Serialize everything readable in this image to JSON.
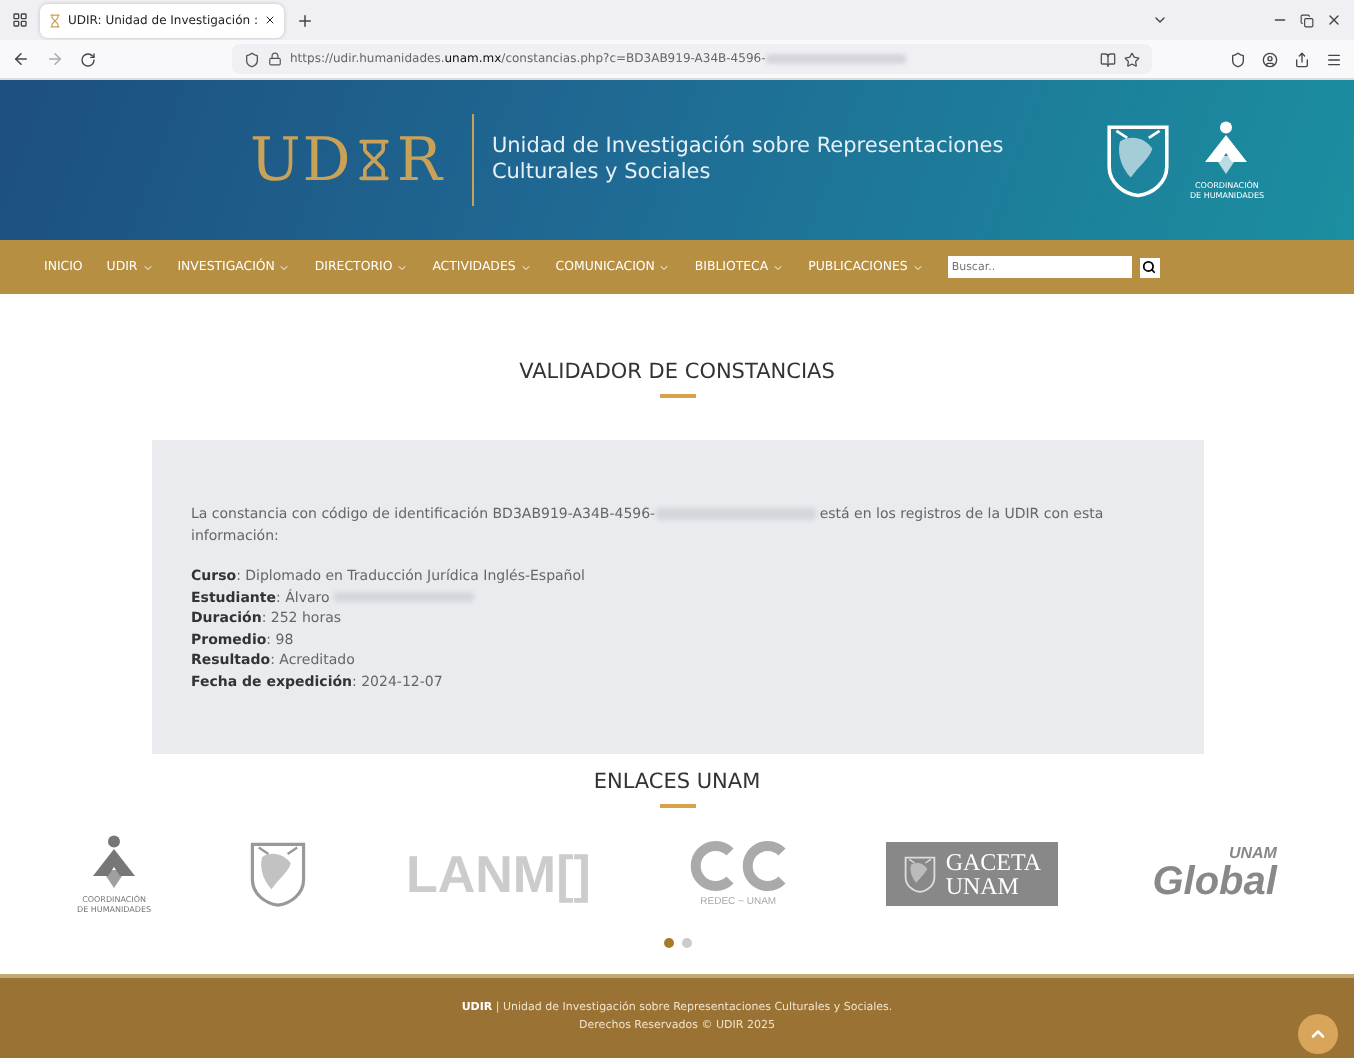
{
  "browser": {
    "tab_title": "UDIR: Unidad de Investigación :",
    "url_host_start": "https://udir.humanidades.",
    "url_host_bold": "unam.mx",
    "url_path": "/constancias.php?c=BD3AB919-A34B-4596-",
    "url_redacted": true
  },
  "header": {
    "logo_start": "UD",
    "logo_end": "R",
    "title_lines": [
      "Unidad de Investigación sobre Representaciones",
      "Culturales y Sociales"
    ],
    "partner_label": [
      "COORDINACIÓN",
      "DE HUMANIDADES"
    ]
  },
  "nav": {
    "items": [
      {
        "label": "INICIO",
        "dropdown": false
      },
      {
        "label": "UDIR",
        "dropdown": true
      },
      {
        "label": "INVESTIGACIÓN",
        "dropdown": true
      },
      {
        "label": "DIRECTORIO",
        "dropdown": true
      },
      {
        "label": "ACTIVIDADES",
        "dropdown": true
      },
      {
        "label": "COMUNICACION",
        "dropdown": true
      },
      {
        "label": "BIBLIOTECA",
        "dropdown": true
      },
      {
        "label": "PUBLICACIONES",
        "dropdown": true
      }
    ],
    "search": {
      "placeholder": "Buscar.."
    }
  },
  "validator": {
    "title": "VALIDADOR DE CONSTANCIAS",
    "intro_before": "La constancia con código de identificación BD3AB919-A34B-4596-",
    "intro_redacted": true,
    "intro_after": " está en los registros de la UDIR con esta información:",
    "fields": [
      {
        "text": "**Curso**: Diplomado en Traducción Jurídica Inglés-Español",
        "redacted": false
      },
      {
        "text": "**Estudiante**: Álvaro",
        "redacted": true
      },
      {
        "text": "**Duración**: 252 horas",
        "redacted": false
      },
      {
        "text": "**Promedio**: 98",
        "redacted": false
      },
      {
        "text": "**Resultado**: Acreditado",
        "redacted": false
      },
      {
        "text": "**Fecha de expedición**: 2024-12-07",
        "redacted": false
      }
    ]
  },
  "links": {
    "title": "ENLACES UNAM",
    "logos": [
      {
        "kind": "coordinacion",
        "lines": [
          "COORDINACIÓN",
          "DE HUMANIDADES"
        ]
      },
      {
        "kind": "escudo"
      },
      {
        "kind": "wordmark",
        "lines": [
          "LANM[]"
        ]
      },
      {
        "kind": "redec",
        "lines": [
          "REDEC ~ UNAM"
        ]
      },
      {
        "kind": "gaceta",
        "lines": [
          "GACETA",
          "UNAM"
        ]
      },
      {
        "kind": "global",
        "lines": [
          "UNAM",
          "Global"
        ]
      }
    ],
    "dots": [
      {
        "selected": true
      },
      {
        "selected": false
      }
    ]
  },
  "footer": {
    "line1": "**UDIR** | Unidad de Investigación sobre Representaciones Culturales y Sociales.",
    "line2": "Derechos Reservados © UDIR 2025"
  }
}
